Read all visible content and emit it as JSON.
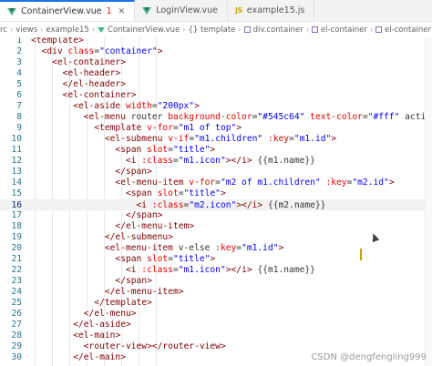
{
  "tabs": [
    {
      "label": "ContainerView.vue",
      "badge": "1",
      "icon": "vue-icon",
      "active": true
    },
    {
      "label": "LoginView.vue",
      "icon": "vue-icon",
      "active": false
    },
    {
      "label": "example15.js",
      "icon": "js-icon",
      "icon_text": "JS",
      "active": false
    }
  ],
  "breadcrumb": [
    "rc",
    "views",
    "example15",
    "ContainerView.vue",
    "{} template",
    "div.container",
    "el-container",
    "el-container"
  ],
  "code_lines": [
    {
      "n": "1",
      "text": "<template>"
    },
    {
      "n": "2",
      "text": "  <div class=\"container\">"
    },
    {
      "n": "3",
      "text": "    <el-container>"
    },
    {
      "n": "4",
      "text": "      <el-header>"
    },
    {
      "n": "5",
      "text": "      </el-header>"
    },
    {
      "n": "6",
      "text": "      <el-container>"
    },
    {
      "n": "7",
      "text": "        <el-aside width=\"200px\">"
    },
    {
      "n": "8",
      "text": "          <el-menu router background-color=\"#545c64\" text-color=\"#fff\" active-te"
    },
    {
      "n": "9",
      "text": "            <template v-for=\"m1 of top\">"
    },
    {
      "n": "10",
      "text": "              <el-submenu v-if=\"m1.children\" :key=\"m1.id\">"
    },
    {
      "n": "11",
      "text": "                <span slot=\"title\">"
    },
    {
      "n": "12",
      "text": "                  <i :class=\"m1.icon\"></i> {{m1.name}}"
    },
    {
      "n": "13",
      "text": "                </span>"
    },
    {
      "n": "14",
      "text": "                <el-menu-item v-for=\"m2 of m1.children\" :key=\"m2.id\">"
    },
    {
      "n": "15",
      "text": "                  <span slot=\"title\">"
    },
    {
      "n": "16",
      "text": "                    <i :class=\"m2.icon\"></i> {{m2.name}}"
    },
    {
      "n": "17",
      "text": "                  </span>"
    },
    {
      "n": "18",
      "text": "                </el-menu-item>"
    },
    {
      "n": "19",
      "text": "              </el-submenu>"
    },
    {
      "n": "20",
      "text": "              <el-menu-item v-else :key=\"m1.id\">"
    },
    {
      "n": "21",
      "text": "                <span slot=\"title\">"
    },
    {
      "n": "22",
      "text": "                  <i :class=\"m1.icon\"></i> {{m1.name}}"
    },
    {
      "n": "23",
      "text": "                </span>"
    },
    {
      "n": "24",
      "text": "              </el-menu-item>"
    },
    {
      "n": "25",
      "text": "            </template>"
    },
    {
      "n": "26",
      "text": "          </el-menu>"
    },
    {
      "n": "27",
      "text": "        </el-aside>"
    },
    {
      "n": "28",
      "text": "        <el-main>"
    },
    {
      "n": "29",
      "text": "          <router-view></router-view>"
    },
    {
      "n": "30",
      "text": "        </el-main>"
    }
  ],
  "current_line": "16",
  "watermark": "CSDN @dengfengling999",
  "colors": {
    "accent": "#1a73e8",
    "line_number": "#237893",
    "tag": "#800000",
    "attr": "#e50000",
    "string": "#0000ff"
  }
}
